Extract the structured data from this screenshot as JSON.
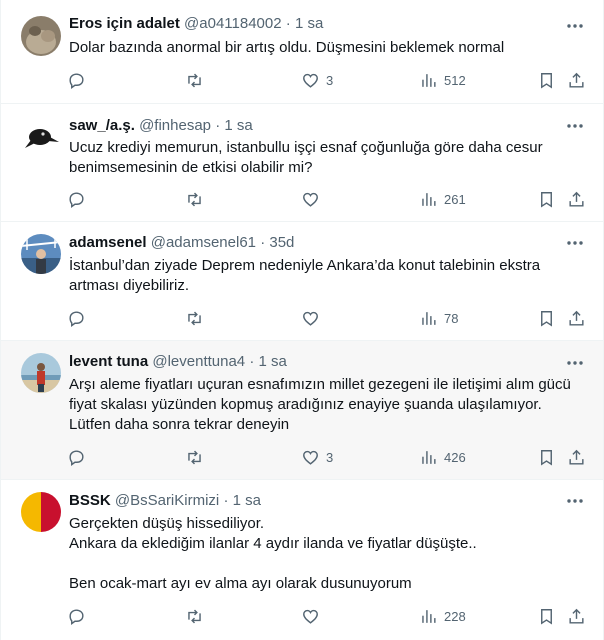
{
  "tweets": [
    {
      "name": "Eros için adalet",
      "handle": "@a041184002",
      "dot": "·",
      "time": "1 sa",
      "text": "Dolar bazında anormal bir artış oldu. Düşmesini beklemek normal",
      "reply_count": "",
      "retweet_count": "",
      "like_count": "3",
      "view_count": "512"
    },
    {
      "name": "saw_/a.ş.",
      "handle": "@finhesap",
      "dot": "·",
      "time": "1 sa",
      "text": "Ucuz krediyi memurun, istanbullu işçi esnaf çoğunluğa göre daha cesur\nbenimsemesinin de etkisi olabilir mi?",
      "reply_count": "",
      "retweet_count": "",
      "like_count": "",
      "view_count": "261"
    },
    {
      "name": "adamsenel",
      "handle": "@adamsenel61",
      "dot": "·",
      "time": "35d",
      "text": "İstanbul’dan ziyade Deprem nedeniyle Ankara’da konut talebinin ekstra\nartması diyebiliriz.",
      "reply_count": "",
      "retweet_count": "",
      "like_count": "",
      "view_count": "78"
    },
    {
      "name": "levent tuna",
      "handle": "@leventtuna4",
      "dot": "·",
      "time": "1 sa",
      "text": "Arşı aleme fiyatları uçuran esnafımızın millet gezegeni ile iletişimi alım gücü\nfiyat skalası yüzünden kopmuş aradığınız enayiye şuanda ulaşılamıyor.\nLütfen daha sonra tekrar deneyin",
      "reply_count": "",
      "retweet_count": "",
      "like_count": "3",
      "view_count": "426"
    },
    {
      "name": "BSSK",
      "handle": "@BsSariKirmizi",
      "dot": "·",
      "time": "1 sa",
      "text": "Gerçekten düşüş hissediliyor.\nAnkara da eklediğim ilanlar 4 aydır ilanda ve fiyatlar düşüşte..\n\nBen ocak-mart ayı ev alma ayı olarak dusunuyorum",
      "reply_count": "",
      "retweet_count": "",
      "like_count": "",
      "view_count": "228"
    }
  ],
  "icons": {
    "reply": "reply-icon",
    "retweet": "retweet-icon",
    "like": "heart-icon",
    "views": "views-chart-icon",
    "bookmark": "bookmark-icon",
    "share": "share-icon",
    "more": "more-icon"
  },
  "colors": {
    "text": "#0f1419",
    "secondary": "#536471",
    "divider": "#eff3f4",
    "highlight_bg": "#f7f7f7"
  }
}
